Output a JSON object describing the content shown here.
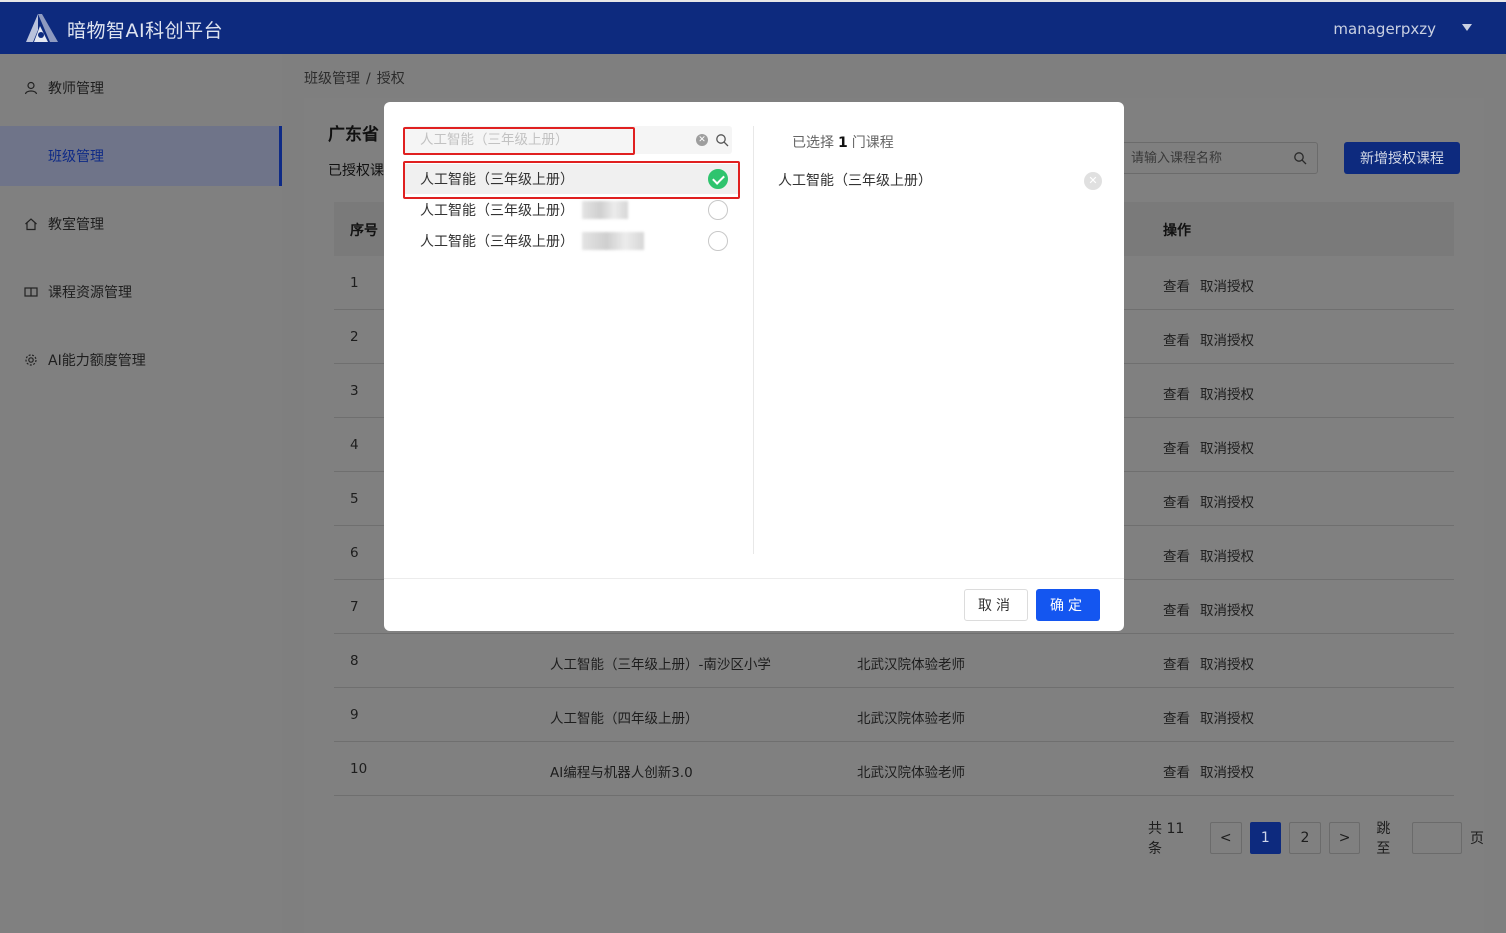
{
  "header": {
    "app_title": "暗物智AI科创平台",
    "user_name": "managerpxzy"
  },
  "sidebar": {
    "items": [
      {
        "label": "教师管理",
        "icon": "user-icon"
      },
      {
        "label": "班级管理",
        "icon": "",
        "active": true
      },
      {
        "label": "教室管理",
        "icon": "home-icon"
      },
      {
        "label": "课程资源管理",
        "icon": "book-icon"
      },
      {
        "label": "AI能力额度管理",
        "icon": "gear-icon"
      }
    ]
  },
  "breadcrumb": {
    "parent": "班级管理",
    "separator": "/",
    "current": "授权"
  },
  "panel": {
    "title": "广东省",
    "subtitle": "已授权课",
    "search_placeholder": "请输入课程名称",
    "add_button": "新增授权课程"
  },
  "table": {
    "headers": {
      "index": "序号",
      "action": "操作"
    },
    "action_view": "查看",
    "action_revoke": "取消授权",
    "rows": [
      {
        "index": "1",
        "course": "",
        "teacher": ""
      },
      {
        "index": "2",
        "course": "",
        "teacher": ""
      },
      {
        "index": "3",
        "course": "",
        "teacher": ""
      },
      {
        "index": "4",
        "course": "",
        "teacher": ""
      },
      {
        "index": "5",
        "course": "",
        "teacher": ""
      },
      {
        "index": "6",
        "course": "",
        "teacher": ""
      },
      {
        "index": "7",
        "course": "",
        "teacher": ""
      },
      {
        "index": "8",
        "course": "人工智能（三年级上册）-南沙区小学",
        "teacher": "北武汉院体验老师"
      },
      {
        "index": "9",
        "course": "人工智能（四年级上册）",
        "teacher": "北武汉院体验老师"
      },
      {
        "index": "10",
        "course": "AI编程与机器人创新3.0",
        "teacher": "北武汉院体验老师"
      }
    ]
  },
  "pager": {
    "total_text": "共 11 条",
    "pages": [
      "1",
      "2"
    ],
    "current_page": "1",
    "prev": "<",
    "next": ">",
    "jump_label": "跳至",
    "page_suffix": "页"
  },
  "modal": {
    "search_value": "人工智能（三年级上册）",
    "options": [
      {
        "label": "人工智能（三年级上册）",
        "checked": true
      },
      {
        "label": "人工智能（三年级上册）",
        "checked": false
      },
      {
        "label": "人工智能（三年级上册）",
        "checked": false
      }
    ],
    "selected_prefix": "已选择",
    "selected_count": "1",
    "selected_suffix": "门课程",
    "selected_items": [
      "人工智能（三年级上册）"
    ],
    "cancel": "取消",
    "confirm": "确定"
  },
  "colors": {
    "header_bg": "#0d2a7e",
    "primary": "#1456f0",
    "check_green": "#2fc46e",
    "highlight_red": "#e02020"
  }
}
